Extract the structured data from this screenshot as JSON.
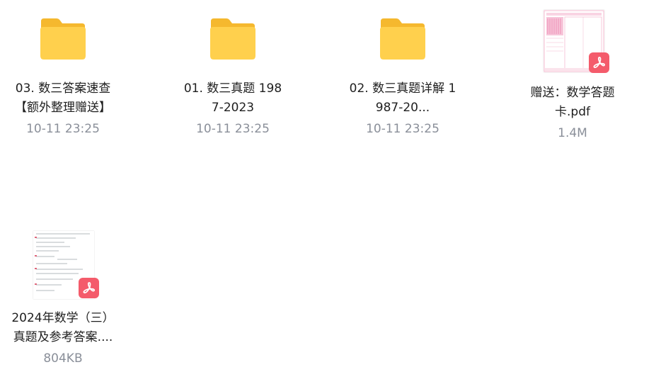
{
  "files": [
    {
      "name_line1": "03. 数三答案速查",
      "name_line2": "【额外整理赠送】",
      "meta": "10-11 23:25",
      "icon": "folder-icon"
    },
    {
      "name_line1": "01. 数三真题 198",
      "name_line2": "7-2023",
      "meta": "10-11 23:25",
      "icon": "folder-icon"
    },
    {
      "name_line1": "02. 数三真题详解 1",
      "name_line2": "987-20...",
      "meta": "10-11 23:25",
      "icon": "folder-icon"
    },
    {
      "name_line1": "赠送：数学答题",
      "name_line2": "卡.pdf",
      "meta": "1.4M",
      "icon": "pdf-icon"
    },
    {
      "name_line1": "2024年数学（三）",
      "name_line2": "真题及参考答案....",
      "meta": "804KB",
      "icon": "pdf-icon"
    }
  ],
  "colors": {
    "folder_back": "#f7c53c",
    "folder_front": "#ffd75a",
    "pdf_badge": "#f45b6b",
    "meta_text": "#8a8f99"
  }
}
